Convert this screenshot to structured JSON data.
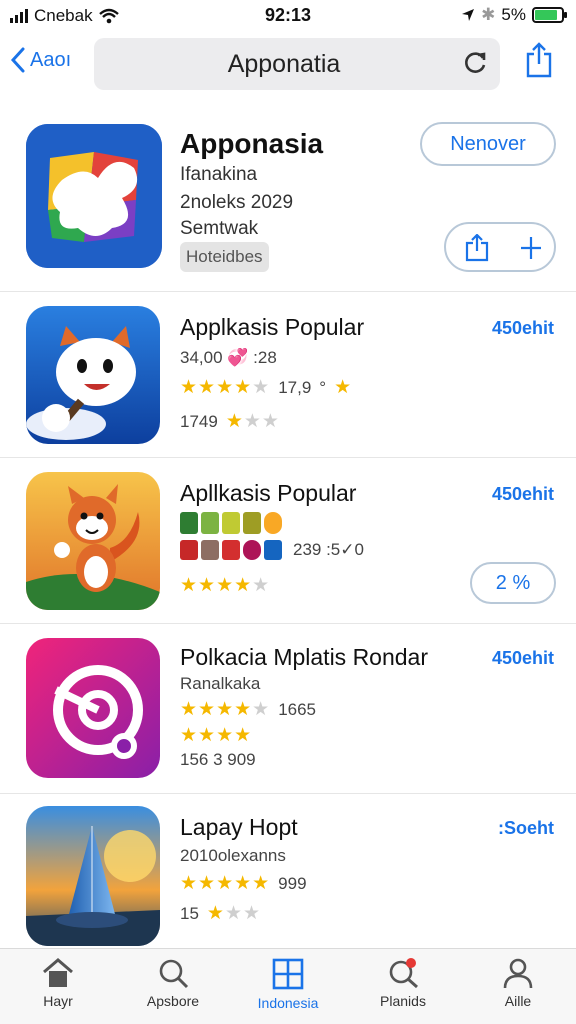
{
  "status": {
    "carrier": "Cnebak",
    "time": "92:13",
    "battery": "5%"
  },
  "nav": {
    "back_label": "Aaoı",
    "title": "Apponatia"
  },
  "featured": {
    "title": "Apponasia",
    "line1": "Ifanakina",
    "line2": "2noleks 2029",
    "line3": "Semtwak",
    "badge": "Hoteidbes",
    "action_label": "Nenover"
  },
  "apps": [
    {
      "name": "Applkasis Popular",
      "price": "450ehit",
      "meta1": "34,00 💞 :28",
      "rating_count": "17,9",
      "meta_extra": "°",
      "rating_text": "1749"
    },
    {
      "name": "Apllkasis Popular",
      "price": "450ehit",
      "meta1": "239 :5✓0",
      "action_label": "2 %"
    },
    {
      "name": "Polkacia Mplatis Rondar",
      "price": "450ehit",
      "meta1": "Ranalkaka",
      "rating_count": "1665",
      "rating_text": "156 3 909"
    },
    {
      "name": "Lapay Hopt",
      "price": ":Soeht",
      "meta1": "2010olexanns",
      "rating_count": "999",
      "rating_text": "15"
    }
  ],
  "tabs": [
    {
      "label": "Hayr",
      "icon": "home-icon"
    },
    {
      "label": "Apsbore",
      "icon": "search-icon"
    },
    {
      "label": "Indonesia",
      "icon": "grid-icon"
    },
    {
      "label": "Planids",
      "icon": "search-badge-icon"
    },
    {
      "label": "Aille",
      "icon": "person-icon"
    }
  ],
  "colors": {
    "accent": "#1a73e8",
    "star": "#f5b800",
    "battery": "#34c759"
  }
}
